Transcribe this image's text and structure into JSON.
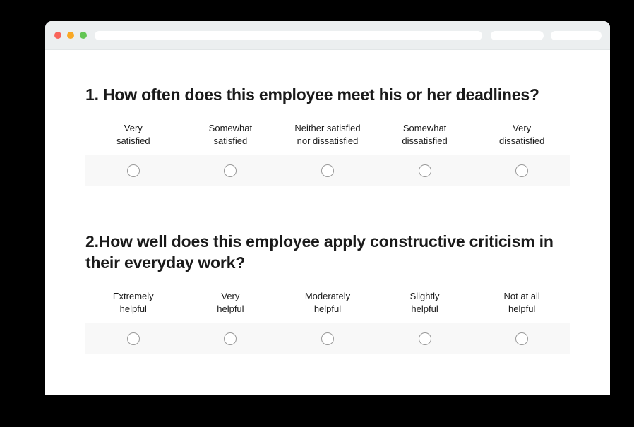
{
  "window": {
    "traffic_lights": [
      {
        "name": "close",
        "color": "#f9655b"
      },
      {
        "name": "minimize",
        "color": "#f9a825"
      },
      {
        "name": "maximize",
        "color": "#62c554"
      }
    ],
    "address_bar_value": "",
    "address_bar_placeholder": "",
    "toolbar_pill_1": "",
    "toolbar_pill_2": ""
  },
  "survey": {
    "questions": [
      {
        "title": "1. How often does this employee meet his or her deadlines?",
        "options": [
          {
            "line1": "Very",
            "line2": "satisfied",
            "selected": false
          },
          {
            "line1": "Somewhat",
            "line2": "satisfied",
            "selected": false
          },
          {
            "line1": "Neither satisfied",
            "line2": "nor dissatisfied",
            "selected": false
          },
          {
            "line1": "Somewhat",
            "line2": "dissatisfied",
            "selected": false
          },
          {
            "line1": "Very",
            "line2": "dissatisfied",
            "selected": false
          }
        ]
      },
      {
        "title": "2.How well does this employee apply constructive criticism in their everyday work?",
        "options": [
          {
            "line1": "Extremely",
            "line2": "helpful",
            "selected": false
          },
          {
            "line1": "Very",
            "line2": "helpful",
            "selected": false
          },
          {
            "line1": "Moderately",
            "line2": "helpful",
            "selected": false
          },
          {
            "line1": "Slightly",
            "line2": "helpful",
            "selected": false
          },
          {
            "line1": "Not at all",
            "line2": "helpful",
            "selected": false
          }
        ]
      }
    ]
  },
  "colors": {
    "page_background": "#000000",
    "window_background": "#ffffff",
    "titlebar": "#eceff0",
    "scale_band": "#f8f8f8",
    "radio_border": "#9a9a9a",
    "text": "#1a1a1a"
  }
}
